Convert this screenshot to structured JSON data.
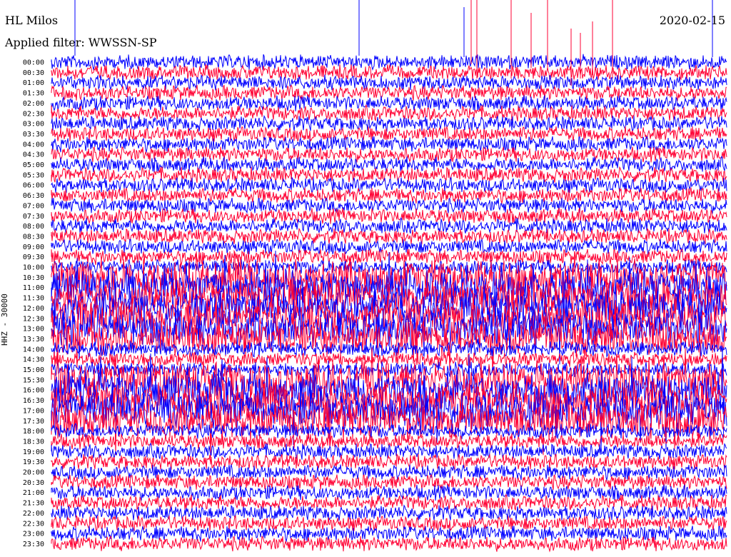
{
  "header": {
    "station": "HL Milos",
    "filter": "Applied filter: WWSSN-SP",
    "date": "2020-02-15"
  },
  "channel_label": "HHZ - 30000",
  "colors": {
    "trace_a": "#0000ff",
    "trace_b": "#ff0033",
    "background": "#ffffff"
  },
  "chart_data": {
    "type": "line",
    "title": "",
    "ylabel": "HHZ - 30000",
    "xlabel": "",
    "grid": false,
    "row_labels": [
      "00:00",
      "00:30",
      "01:00",
      "01:30",
      "02:00",
      "02:30",
      "03:00",
      "03:30",
      "04:00",
      "04:30",
      "05:00",
      "05:30",
      "06:00",
      "06:30",
      "07:00",
      "07:30",
      "08:00",
      "08:30",
      "09:00",
      "09:30",
      "10:00",
      "10:30",
      "11:00",
      "11:30",
      "12:00",
      "12:30",
      "13:00",
      "13:30",
      "14:00",
      "14:30",
      "15:00",
      "15:30",
      "16:00",
      "16:30",
      "17:00",
      "17:30",
      "18:00",
      "18:30",
      "19:00",
      "19:30",
      "20:00",
      "20:30",
      "21:00",
      "21:30",
      "22:00",
      "22:30",
      "23:00",
      "23:30"
    ],
    "row_colors": [
      "trace_a",
      "trace_b"
    ],
    "noisy_rows": [
      "10:30",
      "11:00",
      "11:30",
      "12:00",
      "12:30",
      "13:00",
      "13:30",
      "15:30",
      "16:00",
      "16:30",
      "17:00",
      "17:30"
    ]
  }
}
